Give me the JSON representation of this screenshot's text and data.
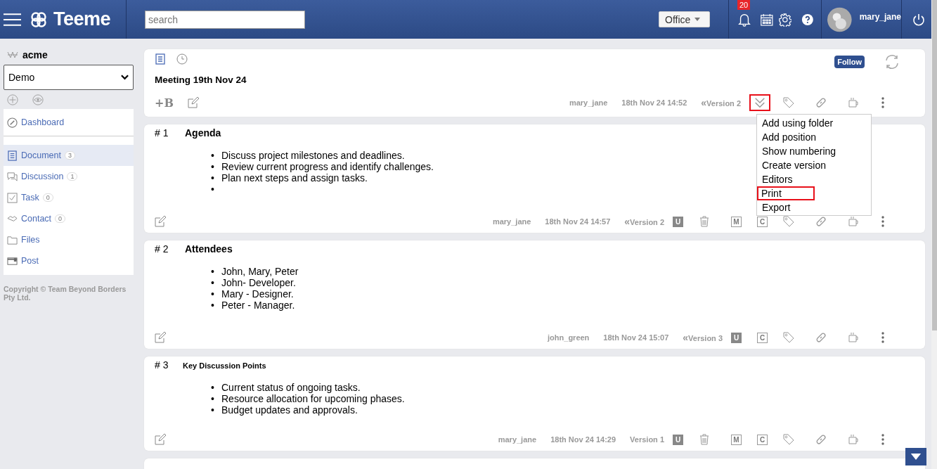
{
  "topbar": {
    "brand": "Teeme",
    "search": {
      "placeholder": "search"
    },
    "space_select": "Office",
    "notifications": "20",
    "user": "mary_jane"
  },
  "sidebar": {
    "workspace": "acme",
    "project_select": "Demo",
    "dashboard": "Dashboard",
    "items": [
      {
        "label": "Document",
        "count": "3",
        "selected": true
      },
      {
        "label": "Discussion",
        "count": "1",
        "selected": false
      },
      {
        "label": "Task",
        "count": "0",
        "selected": false
      },
      {
        "label": "Contact",
        "count": "0",
        "selected": false
      },
      {
        "label": "Files",
        "selected": false
      },
      {
        "label": "Post",
        "selected": false
      }
    ],
    "copyright": "Copyright © Team Beyond Borders Pty Ltd."
  },
  "document": {
    "title": "Meeting 19th Nov 24",
    "follow": "Follow",
    "add_block": "+B",
    "author": "mary_jane",
    "date": "18th Nov 24 14:52",
    "version_mark": "«",
    "version": "Version 2",
    "menu_button_highlighted": true,
    "menu": [
      {
        "label": "Add using folder",
        "highlighted": false
      },
      {
        "label": "Add position",
        "highlighted": false
      },
      {
        "label": "Show numbering",
        "highlighted": false
      },
      {
        "label": "Create version",
        "highlighted": false
      },
      {
        "label": "Editors",
        "highlighted": false
      },
      {
        "label": "Print",
        "highlighted": true
      },
      {
        "label": "Export",
        "highlighted": false
      }
    ]
  },
  "sections": [
    {
      "number": "# 1",
      "title": "Agenda",
      "small_title": false,
      "marker": "•",
      "bullets": [
        "Discuss project milestones and deadlines.",
        "Review current progress and identify challenges.",
        "Plan next steps and assign tasks."
      ],
      "trailing_empty_bullet": true,
      "author": "mary_jane",
      "date": "18th Nov 24 14:57",
      "version_mark": "«",
      "version": "Version 2",
      "actions": [
        {
          "kind": "letter",
          "label": "U",
          "filled": true
        },
        {
          "kind": "trash"
        },
        {
          "kind": "letter",
          "label": "M",
          "filled": false
        },
        {
          "kind": "letter",
          "label": "C",
          "filled": false
        },
        {
          "kind": "tag"
        },
        {
          "kind": "link"
        },
        {
          "kind": "cup"
        },
        {
          "kind": "more"
        }
      ]
    },
    {
      "number": "# 2",
      "title": "Attendees",
      "small_title": false,
      "marker": "•",
      "bullets": [
        "John, Mary, Peter",
        "John- Developer.",
        "Mary - Designer.",
        "Peter - Manager."
      ],
      "trailing_empty_bullet": false,
      "author": "john_green",
      "date": "18th Nov 24 15:07",
      "version_mark": "«",
      "version": "Version 3",
      "actions": [
        {
          "kind": "letter",
          "label": "U",
          "filled": true
        },
        {
          "kind": "letter",
          "label": "C",
          "filled": false
        },
        {
          "kind": "tag"
        },
        {
          "kind": "link"
        },
        {
          "kind": "cup"
        },
        {
          "kind": "more"
        }
      ]
    },
    {
      "number": "# 3",
      "title": "Key Discussion Points",
      "small_title": true,
      "marker": "•",
      "bullets": [
        "Current status of ongoing tasks.",
        "Resource allocation for upcoming phases.",
        "Budget updates and approvals."
      ],
      "trailing_empty_bullet": false,
      "author": "mary_jane",
      "date": "18th Nov 24 14:29",
      "version": "Version 1",
      "actions": [
        {
          "kind": "letter",
          "label": "U",
          "filled": true
        },
        {
          "kind": "trash"
        },
        {
          "kind": "letter",
          "label": "M",
          "filled": false
        },
        {
          "kind": "letter",
          "label": "C",
          "filled": false
        },
        {
          "kind": "tag"
        },
        {
          "kind": "link"
        },
        {
          "kind": "cup"
        },
        {
          "kind": "more"
        }
      ]
    }
  ]
}
